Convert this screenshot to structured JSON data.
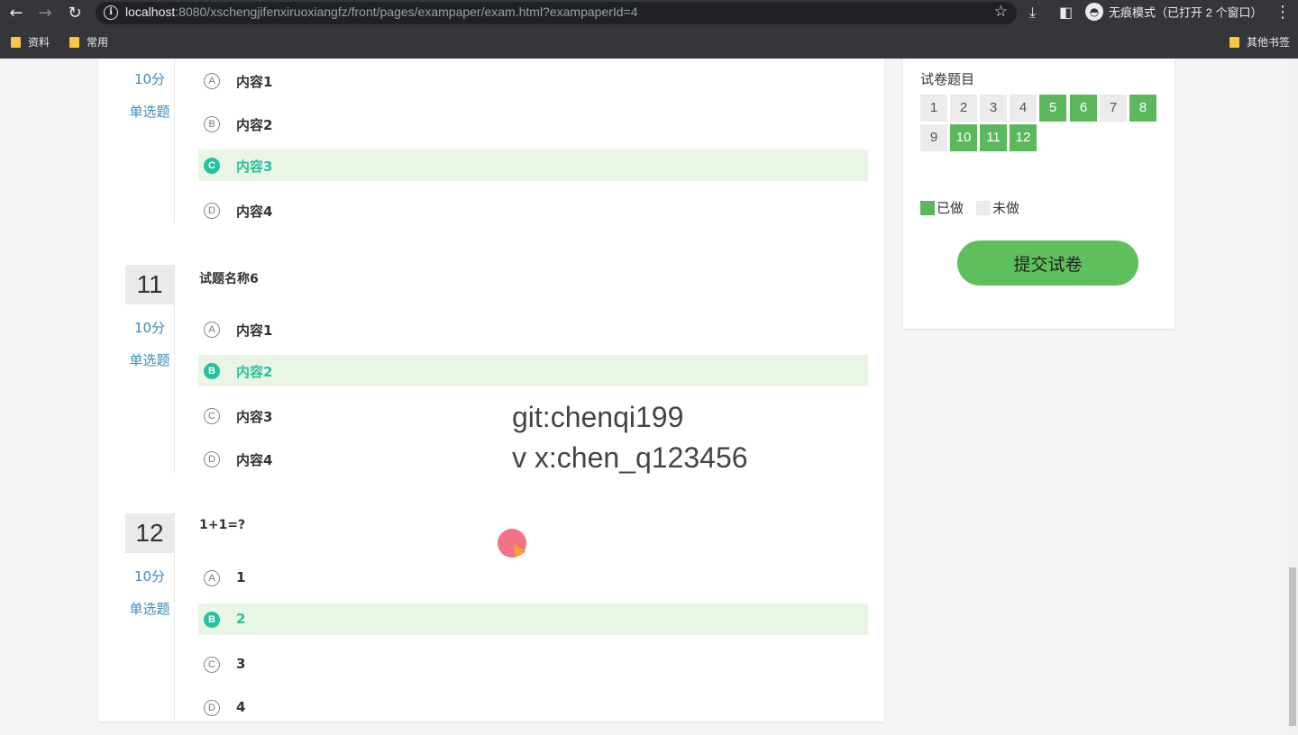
{
  "browser": {
    "url_host": "localhost",
    "url_rest": ":8080/xschengjifenxiruoxiangfz/front/pages/exampaper/exam.html?exampaperId=4",
    "incognito_label": "无痕模式（已打开 2 个窗口）",
    "bookmarks": [
      "资料",
      "常用"
    ],
    "other_bookmarks": "其他书签"
  },
  "questions": [
    {
      "score": "10分",
      "type": "单选题",
      "options": [
        {
          "letter": "A",
          "text": "内容1",
          "selected": false
        },
        {
          "letter": "B",
          "text": "内容2",
          "selected": false
        },
        {
          "letter": "C",
          "text": "内容3",
          "selected": true
        },
        {
          "letter": "D",
          "text": "内容4",
          "selected": false
        }
      ]
    },
    {
      "number": "11",
      "title": "试题名称6",
      "score": "10分",
      "type": "单选题",
      "options": [
        {
          "letter": "A",
          "text": "内容1",
          "selected": false
        },
        {
          "letter": "B",
          "text": "内容2",
          "selected": true
        },
        {
          "letter": "C",
          "text": "内容3",
          "selected": false
        },
        {
          "letter": "D",
          "text": "内容4",
          "selected": false
        }
      ]
    },
    {
      "number": "12",
      "title": "1+1=?",
      "score": "10分",
      "type": "单选题",
      "options": [
        {
          "letter": "A",
          "text": "1",
          "selected": false
        },
        {
          "letter": "B",
          "text": "2",
          "selected": true
        },
        {
          "letter": "C",
          "text": "3",
          "selected": false
        },
        {
          "letter": "D",
          "text": "4",
          "selected": false
        }
      ]
    }
  ],
  "watermark": {
    "line1": "git:chenqi199",
    "line2": "v x:chen_q123456"
  },
  "panel": {
    "title": "试卷题目",
    "cells": [
      {
        "n": "1",
        "done": false
      },
      {
        "n": "2",
        "done": false
      },
      {
        "n": "3",
        "done": false
      },
      {
        "n": "4",
        "done": false
      },
      {
        "n": "5",
        "done": true
      },
      {
        "n": "6",
        "done": true
      },
      {
        "n": "7",
        "done": false
      },
      {
        "n": "8",
        "done": true
      },
      {
        "n": "9",
        "done": false
      },
      {
        "n": "10",
        "done": true
      },
      {
        "n": "11",
        "done": true
      },
      {
        "n": "12",
        "done": true
      }
    ],
    "legend_done": "已做",
    "legend_todo": "未做",
    "submit_label": "提交试卷",
    "colors": {
      "done": "#5cb85c",
      "todo": "#ebebeb",
      "selected_option": "#25c39c"
    }
  }
}
